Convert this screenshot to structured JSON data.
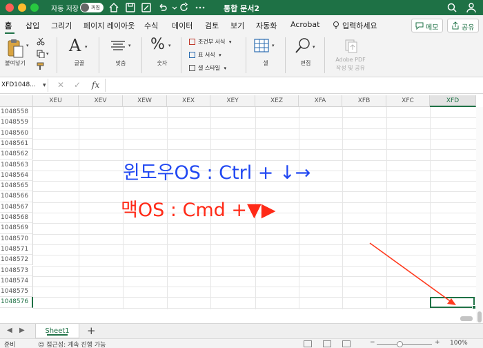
{
  "window": {
    "title": "통합 문서2",
    "autosave_label": "자동 저장",
    "autosave_state": "꺼짐"
  },
  "ribbon_tabs": [
    "홈",
    "삽입",
    "그리기",
    "페이지 레이아웃",
    "수식",
    "데이터",
    "검토",
    "보기",
    "자동화",
    "Acrobat"
  ],
  "tell_me": "입력하세요",
  "buttons": {
    "comments": "메모",
    "share": "공유"
  },
  "ribbon": {
    "paste": "붙여넣기",
    "font": "글꼴",
    "alignment": "맞춤",
    "number": "숫자",
    "conditional_format": "조건부 서식",
    "table_format": "표 서식",
    "cell_style": "셀 스타일",
    "cells": "셀",
    "editing": "편집",
    "adobe_line1": "Adobe PDF",
    "adobe_line2": "작성 및 공유"
  },
  "formula_bar": {
    "name_box": "XFD1048...",
    "fx": "fx",
    "cancel": "✕",
    "enter": "✓"
  },
  "columns": [
    "XEU",
    "XEV",
    "XEW",
    "XEX",
    "XEY",
    "XEZ",
    "XFA",
    "XFB",
    "XFC",
    "XFD"
  ],
  "selected_column": "XFD",
  "rows": [
    "1048558",
    "1048559",
    "1048560",
    "1048561",
    "1048562",
    "1048563",
    "1048564",
    "1048565",
    "1048566",
    "1048567",
    "1048568",
    "1048569",
    "1048570",
    "1048571",
    "1048572",
    "1048573",
    "1048574",
    "1048575",
    "1048576"
  ],
  "selected_row": "1048576",
  "annotations": {
    "windows": "윈도우OS : Ctrl + ↓→",
    "mac": "맥OS : Cmd +▼▶",
    "windows_color": "#2148f2",
    "mac_color": "#ff2a17"
  },
  "sheets": [
    "Sheet1"
  ],
  "status": {
    "ready": "준비",
    "accessibility": "접근성: 계속 진행 가능",
    "zoom": "100%"
  },
  "colors": {
    "accent": "#1e7145"
  }
}
